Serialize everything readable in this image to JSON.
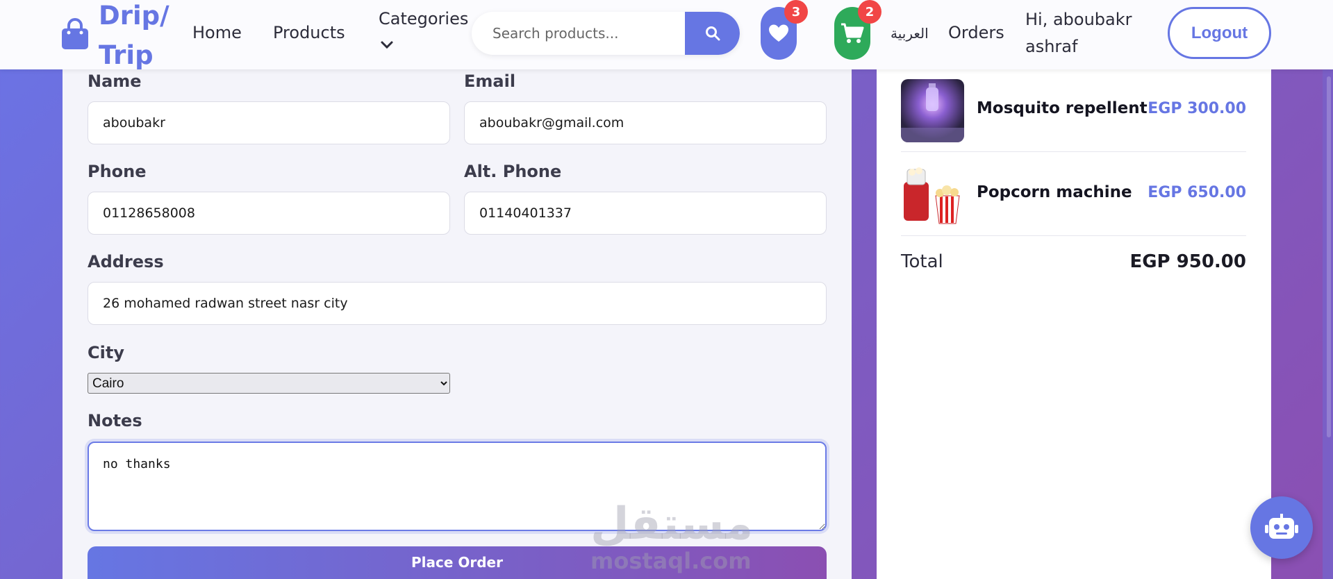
{
  "brand": {
    "name": "Drip/ Trip",
    "accent": "#6676e3"
  },
  "nav": {
    "home": "Home",
    "products": "Products",
    "categories": "Categories",
    "language": "العربية",
    "orders": "Orders",
    "greeting": "Hi, aboubakr ashraf",
    "logout": "Logout"
  },
  "search": {
    "placeholder": "Search products...",
    "value": ""
  },
  "wishlist": {
    "count": "3",
    "icon": "heart-icon"
  },
  "cart": {
    "count": "2",
    "icon": "cart-icon"
  },
  "form": {
    "name_label": "Name",
    "name_value": "aboubakr",
    "email_label": "Email",
    "email_value": "aboubakr@gmail.com",
    "phone_label": "Phone",
    "phone_value": "01128658008",
    "alt_phone_label": "Alt. Phone",
    "alt_phone_value": "01140401337",
    "address_label": "Address",
    "address_value": "26 mohamed radwan street nasr city",
    "city_label": "City",
    "city_value": "Cairo",
    "notes_label": "Notes",
    "notes_value": "no thanks",
    "submit": "Place Order"
  },
  "summary": {
    "items": [
      {
        "name": "Mosquito repellent",
        "price": "EGP 300.00"
      },
      {
        "name": "Popcorn machine",
        "price": "EGP 650.00"
      }
    ],
    "total_label": "Total",
    "total_value": "EGP 950.00"
  },
  "watermark": {
    "arabic": "مستقل",
    "latin": "mostaql.com"
  },
  "colors": {
    "cart_green": "#2eaa5a",
    "badge_red": "#f14646",
    "bg_purple": "#7a5fc6"
  }
}
